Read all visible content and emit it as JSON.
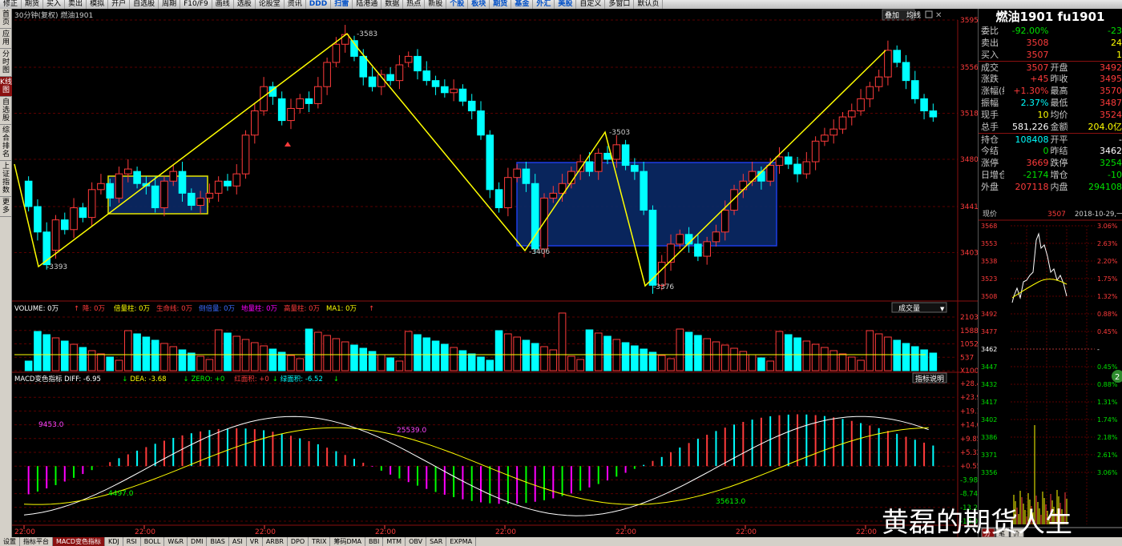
{
  "toolbar": {
    "items": [
      "修正",
      "期货",
      "买入",
      "卖出",
      "模拟",
      "开户",
      "自选股",
      "周期",
      "F10/F9",
      "画线",
      "选股",
      "论股堂",
      "资讯",
      "DDD",
      "扫雷",
      "陆港通",
      "数据",
      "热点",
      "新股",
      "个股",
      "板块",
      "期货",
      "基金",
      "外汇",
      "美股",
      "自定义",
      "多窗口",
      "默认页"
    ]
  },
  "leftnav": {
    "items": [
      "首页",
      "应用",
      "分时图",
      "K线图",
      "自选股",
      "综合排名",
      "上证指数",
      "更多"
    ]
  },
  "chart": {
    "header": "30分钟(复权)  燃油1901",
    "top_right_a": "叠加",
    "top_right_b": "均线",
    "price_axis": [
      "3595",
      "3556",
      "3518",
      "3480",
      "3441",
      "3403"
    ],
    "price_labels": {
      "low1": "3393",
      "high1": "3583",
      "low2": "3406",
      "high2": "3503",
      "low3": "3376"
    },
    "volume": {
      "header_items": [
        {
          "text": "VOLUME: 0万",
          "color": "#ffffff"
        },
        {
          "text": "↑",
          "color": "#ff3b3b"
        },
        {
          "text": "降: 0万",
          "color": "#ff3b3b"
        },
        {
          "text": "倍量柱: 0万",
          "color": "#ffff00"
        },
        {
          "text": "生命线: 0万",
          "color": "#ff3b3b"
        },
        {
          "text": "倒倍量: 0万",
          "color": "#3b6bff"
        },
        {
          "text": "地量柱: 0万",
          "color": "#ff00ff"
        },
        {
          "text": "高量柱: 0万",
          "color": "#ff3b3b"
        },
        {
          "text": "MA1: 0万",
          "color": "#ffff00"
        },
        {
          "text": "↑",
          "color": "#ff3b3b"
        }
      ],
      "dropdown": "成交量",
      "axis": [
        "2103",
        "1588",
        "1052",
        "537",
        "X100"
      ]
    },
    "macd": {
      "header_items": [
        {
          "text": "MACD变色指标  DIFF: -6.95",
          "color": "#ffffff"
        },
        {
          "text": "↓",
          "color": "#00ff00"
        },
        {
          "text": "DEA: -3.68",
          "color": "#ffff00"
        },
        {
          "text": "↓",
          "color": "#00ff00"
        },
        {
          "text": "ZERO: +0",
          "color": "#00ff00"
        },
        {
          "text": "红面积: +0",
          "color": "#ff3b3b"
        },
        {
          "text": "↓",
          "color": "#00ff00"
        },
        {
          "text": "绿面积: -6.52",
          "color": "#00ffff"
        },
        {
          "text": "↓",
          "color": "#00ff00"
        }
      ],
      "help_button": "指标说明",
      "axis": [
        "+28.44",
        "+23.90",
        "+19.14",
        "+14.61",
        "+9.85",
        "+5.32",
        "+0.556",
        "-3.98",
        "-8.74",
        "-13.27",
        "-18.03"
      ],
      "labels": {
        "a": "9453.0",
        "b": "4497.0",
        "c": "25539.0",
        "d": "35613.0"
      }
    },
    "time_labels": [
      "22:00",
      "22:00",
      "22:00",
      "22:00",
      "22:00",
      "22:00",
      "22:00",
      "22:00"
    ]
  },
  "quote": {
    "title": "燃油1901 fu1901",
    "rows": [
      {
        "l": "委比",
        "v": "-92.00%",
        "vc": "green",
        "l2": "",
        "v2": "-23",
        "v2c": "green"
      },
      {
        "l": "卖出",
        "v": "3508",
        "vc": "red",
        "l2": "",
        "v2": "24",
        "v2c": "yellow"
      },
      {
        "l": "买入",
        "v": "3507",
        "vc": "red",
        "l2": "",
        "v2": "1",
        "v2c": "yellow"
      },
      {
        "l": "成交",
        "v": "3507",
        "vc": "red",
        "l2": "开盘",
        "v2": "3492",
        "v2c": "red",
        "sep": true
      },
      {
        "l": "涨跌",
        "v": "+45",
        "vc": "red",
        "l2": "昨收",
        "v2": "3495",
        "v2c": "red"
      },
      {
        "l": "涨幅(结)",
        "v": "+1.30%",
        "vc": "red",
        "l2": "最高",
        "v2": "3570",
        "v2c": "red"
      },
      {
        "l": "振幅",
        "v": "2.37%",
        "vc": "cyan",
        "l2": "最低",
        "v2": "3487",
        "v2c": "red"
      },
      {
        "l": "现手",
        "v": "10",
        "vc": "yellow",
        "l2": "均价",
        "v2": "3524",
        "v2c": "red"
      },
      {
        "l": "总手",
        "v": "581,226",
        "vc": "white",
        "l2": "金额",
        "v2": "204.0亿",
        "v2c": "yellow"
      },
      {
        "l": "持仓",
        "v": "108408",
        "vc": "cyan",
        "l2": "开平",
        "v2": "-",
        "v2c": "white",
        "sep": true
      },
      {
        "l": "今结",
        "v": "0",
        "vc": "green",
        "l2": "昨结",
        "v2": "3462",
        "v2c": "white"
      },
      {
        "l": "涨停",
        "v": "3669",
        "vc": "red",
        "l2": "跌停",
        "v2": "3254",
        "v2c": "green"
      },
      {
        "l": "日增仓",
        "v": "-2174",
        "vc": "green",
        "l2": "增仓",
        "v2": "-10",
        "v2c": "green"
      },
      {
        "l": "外盘",
        "v": "207118",
        "vc": "red",
        "l2": "内盘",
        "v2": "294108",
        "v2c": "green"
      }
    ]
  },
  "intraday": {
    "now_label": "现价",
    "now_value": "3507",
    "date": "2018-10-29,一",
    "left_axis": [
      "3568",
      "3553",
      "3538",
      "3523",
      "3508",
      "3492",
      "3477",
      "3462",
      "3447",
      "3432",
      "3417",
      "3402",
      "3386",
      "3371",
      "3356"
    ],
    "right_axis": [
      "3.06%",
      "2.63%",
      "2.20%",
      "1.75%",
      "1.32%",
      "0.88%",
      "0.45%",
      "-",
      "0.45%",
      "0.88%",
      "1.31%",
      "1.74%",
      "2.18%",
      "2.61%",
      "3.06%"
    ],
    "right_colors": [
      "#ff3b3b",
      "#ff3b3b",
      "#ff3b3b",
      "#ff3b3b",
      "#ff3b3b",
      "#ff3b3b",
      "#ff3b3b",
      "#ffffff",
      "#00e000",
      "#00e000",
      "#00e000",
      "#00e000",
      "#00e000",
      "#00e000",
      "#00e000"
    ],
    "bottom_tabs": [
      "分",
      "笔",
      "价"
    ]
  },
  "bottom_tabs": {
    "items": [
      "设置",
      "指标平台",
      "MACD变色指标",
      "KDJ",
      "RSI",
      "BOLL",
      "W&R",
      "DMI",
      "BIAS",
      "ASI",
      "VR",
      "ARBR",
      "DPO",
      "TRIX",
      "筹码DMA",
      "BBI",
      "MTM",
      "OBV",
      "SAR",
      "EXPMA"
    ],
    "active_index": 2
  },
  "watermark": "黄磊的期货人生",
  "colors": {
    "up": "#ff3b3b",
    "down": "#00ffff",
    "bg": "#000000",
    "zigzag": "#ffff00",
    "box_fill": "#0a2a66",
    "box_border": "#2244ff"
  }
}
